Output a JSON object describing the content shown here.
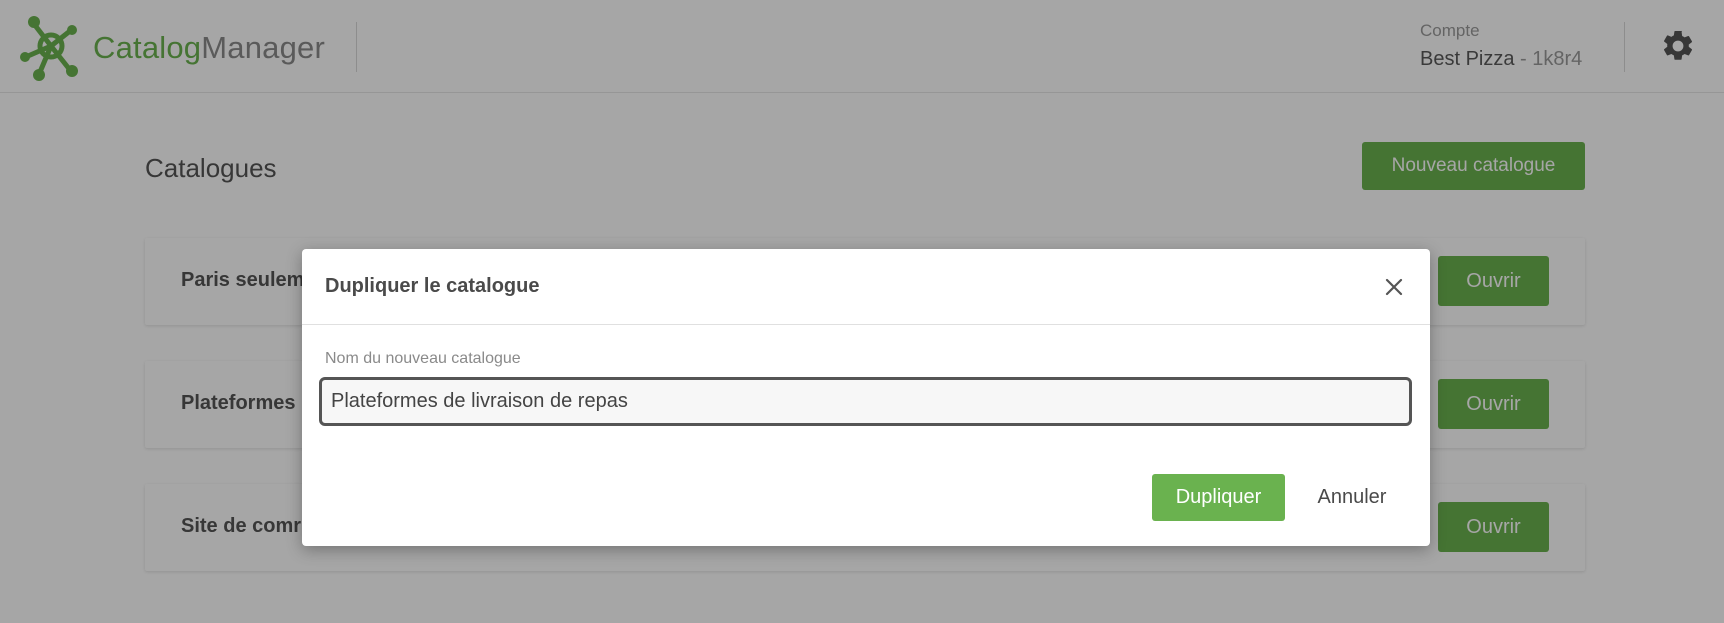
{
  "header": {
    "brand_part1": "Catalog",
    "brand_part2": "Manager",
    "account_label": "Compte",
    "account_name": "Best Pizza",
    "account_separator": " - ",
    "account_code": "1k8r4",
    "settings_icon": "gear-icon",
    "logo_icon": "molecule-logo-icon"
  },
  "main": {
    "title": "Catalogues",
    "new_button": "Nouveau catalogue",
    "catalogs": [
      {
        "name": "Paris seulem",
        "open_label": "Ouvrir"
      },
      {
        "name": "Plateformes",
        "open_label": "Ouvrir"
      },
      {
        "name": "Site de comr",
        "open_label": "Ouvrir"
      }
    ]
  },
  "modal": {
    "title": "Dupliquer le catalogue",
    "close_icon": "close-icon",
    "field_label": "Nom du nouveau catalogue",
    "field_value": "Plateformes de livraison de repas",
    "duplicate_button": "Dupliquer",
    "cancel_button": "Annuler"
  },
  "colors": {
    "accent": "#6ab24f",
    "brand_gray": "#8a8a8a",
    "overlay": "rgba(0,0,0,0.35)"
  }
}
